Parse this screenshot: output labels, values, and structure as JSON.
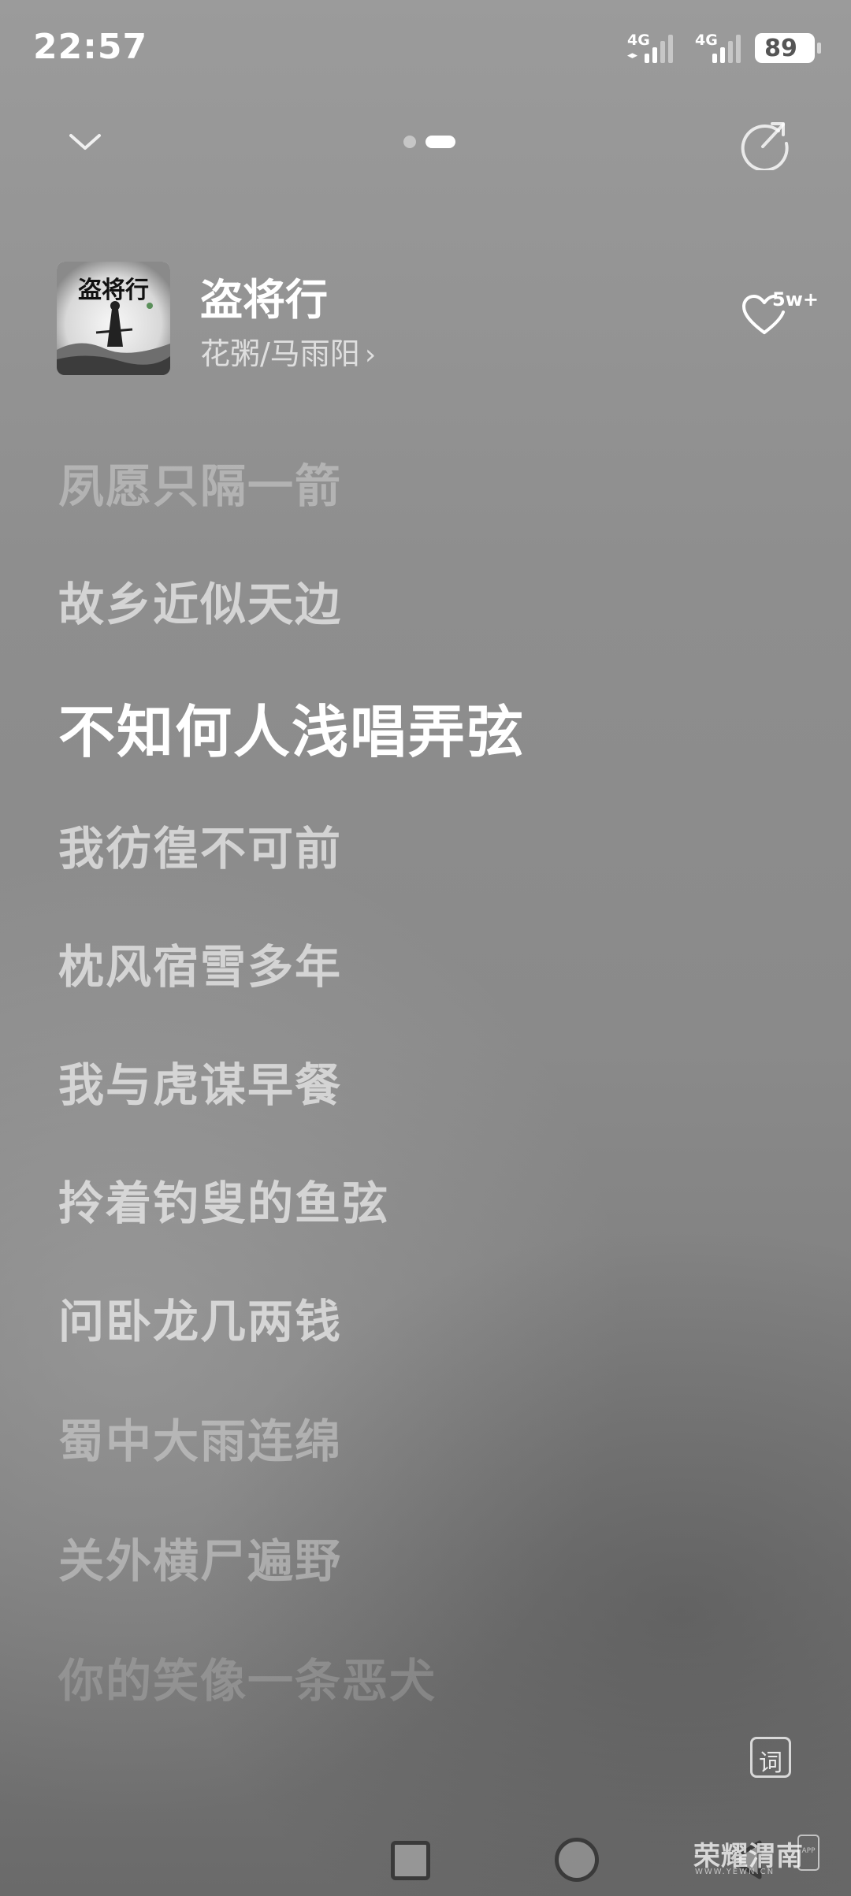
{
  "status_bar": {
    "time": "22:57",
    "sim1_label": "4G",
    "sim2_label": "4G",
    "sim1_arrows": "◂▸",
    "battery": "89"
  },
  "header": {
    "collapse_icon": "chevron-down-icon",
    "share_icon": "share-icon",
    "pages_total": 2,
    "active_page": 2
  },
  "song": {
    "title": "盗将行",
    "artist": "花粥/马雨阳",
    "artist_chevron": "›",
    "cover_text": "盗将行",
    "like_count": "5w+"
  },
  "lyrics": [
    {
      "text": "夙愿只隔一箭",
      "state": "past"
    },
    {
      "text": "故乡近似天边",
      "state": "normal"
    },
    {
      "text": "不知何人浅唱弄弦",
      "state": "current"
    },
    {
      "text": "我彷徨不可前",
      "state": "normal"
    },
    {
      "text": "枕风宿雪多年",
      "state": "normal"
    },
    {
      "text": "我与虎谋早餐",
      "state": "normal"
    },
    {
      "text": "拎着钓叟的鱼弦",
      "state": "normal"
    },
    {
      "text": "问卧龙几两钱",
      "state": "normal"
    },
    {
      "text": "蜀中大雨连绵",
      "state": "fading"
    },
    {
      "text": "关外横尸遍野",
      "state": "fading"
    },
    {
      "text": "你的笑像一条恶犬",
      "state": "faded"
    }
  ],
  "lyric_toggle": {
    "label": "词"
  },
  "nav_bar": {
    "recent_icon": "square-icon",
    "home_icon": "circle-icon",
    "back_icon": "back-triangle-icon"
  },
  "watermark": {
    "text": "荣耀渭南",
    "sub": "WWW.YEWN.CN",
    "app": "APP"
  }
}
